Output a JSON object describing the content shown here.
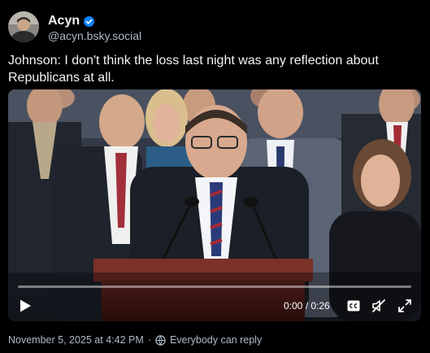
{
  "author": {
    "display_name": "Acyn",
    "handle": "@acyn.bsky.social",
    "verified": true
  },
  "post": {
    "text": "Johnson: I don't think the loss last night was any reflection about Republicans at all."
  },
  "video": {
    "time_display": "0:00 / 0:26",
    "progress": 0.0
  },
  "meta": {
    "timestamp": "November 5, 2025 at 4:42 PM",
    "separator": "·",
    "reply_setting": "Everybody can reply"
  },
  "icons": {
    "verified": "verified-check-icon",
    "play": "play-icon",
    "cc": "closed-captions-icon",
    "mute": "muted-speaker-icon",
    "fullscreen": "fullscreen-icon",
    "reply": "everybody-reply-icon"
  },
  "colors": {
    "background": "#000000",
    "text": "#f1f3f5",
    "muted_text": "#aebbc9",
    "verified_blue": "#1083fe"
  }
}
